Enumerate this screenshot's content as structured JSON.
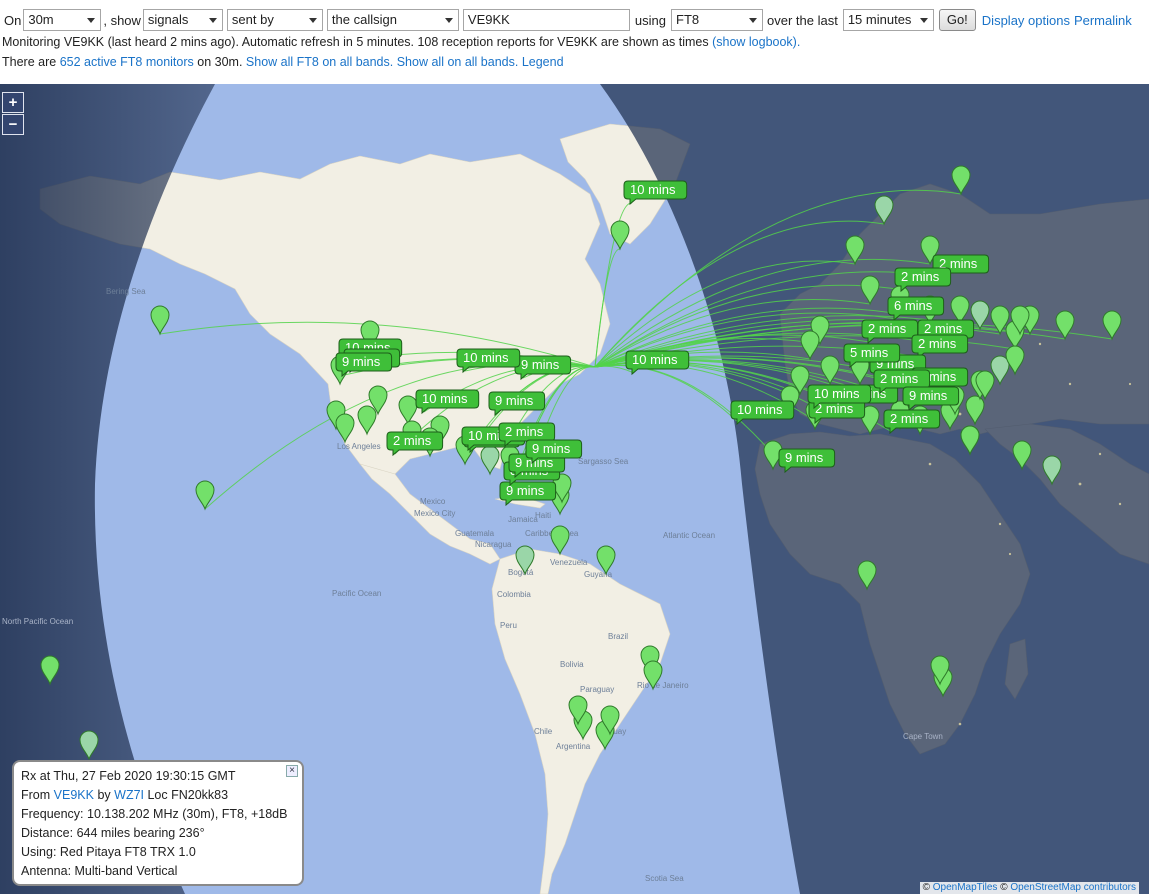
{
  "controls": {
    "on_label": "On",
    "band": "30m",
    "show_label": ", show",
    "show": "signals",
    "direction": "sent by",
    "target": "the callsign",
    "callsign": "VE9KK",
    "using_label": "using",
    "mode": "FT8",
    "over_label": "over the last",
    "period": "15 minutes",
    "go_label": "Go!",
    "display_options": "Display options",
    "permalink": "Permalink"
  },
  "status": {
    "monitoring_text": "Monitoring VE9KK (last heard 2 mins ago). Automatic refresh in 5 minutes. 108 reception reports for VE9KK are shown as times",
    "show_logbook": "(show logbook).",
    "there_are": "There are",
    "active_monitors": "652 active FT8 monitors",
    "on_band": "on 30m.",
    "show_all_ft8": "Show all FT8 on all bands.",
    "show_all": "Show all on all bands.",
    "legend": "Legend"
  },
  "map": {
    "zoom_in": "+",
    "zoom_out": "−",
    "marker_labels": [
      "10 mins",
      "9 mins",
      "10 mins",
      "9 mins",
      "10 mins",
      "9 mins",
      "9 mins",
      "8 mins",
      "9 mins",
      "2 mins",
      "10 mins",
      "2 mins",
      "10 mins",
      "9 mins",
      "2 mins",
      "6 mins",
      "2 mins",
      "2 mins",
      "2 mins",
      "9 mins",
      "5 mins",
      "2 mins",
      "9 mins",
      "2 mins",
      "9 mins",
      "10 mins",
      "2 mins",
      "2 mins",
      "9 mins",
      "10 mins",
      "9 mins",
      "10 mins",
      "2 mins",
      "9 mins"
    ],
    "geo_labels": [
      "Bering Sea",
      "Los Angeles",
      "Mexico",
      "Mexico City",
      "Guatemala",
      "Nicaragua",
      "Jamaica",
      "Haiti",
      "Caribbean Sea",
      "Venezuela",
      "Bogotá",
      "Guyana",
      "Colombia",
      "Peru",
      "Brazil",
      "Bolivia",
      "Paraguay",
      "Chile",
      "Argentina",
      "Uruguay",
      "Rio de Janeiro",
      "North Pacific Ocean",
      "Pacific Ocean",
      "Atlantic Ocean",
      "Sargasso Sea",
      "Cape Town",
      "Scotia Sea"
    ],
    "colors": {
      "ocean": "#9fb9e8",
      "land": "#f2efe4",
      "night": "#1f2f4f",
      "marker": "#73e06a",
      "marker_border": "#2f7a2a",
      "path": "#52d24a"
    }
  },
  "popup": {
    "line1": "Rx at Thu, 27 Feb 2020 19:30:15 GMT",
    "from_label": "From",
    "from_call": "VE9KK",
    "by_label": "by",
    "by_call": "WZ7I",
    "loc": "Loc FN20kk83",
    "frequency": "Frequency: 10.138.202 MHz (30m), FT8, +18dB",
    "distance": "Distance: 644 miles bearing 236°",
    "using": "Using: Red Pitaya FT8 TRX 1.0",
    "antenna": "Antenna: Multi-band Vertical",
    "close": "×"
  },
  "attribution": {
    "copy1": "©",
    "openmaptiles": "OpenMapTiles",
    "copy2": "©",
    "osm": "OpenStreetMap contributors"
  }
}
